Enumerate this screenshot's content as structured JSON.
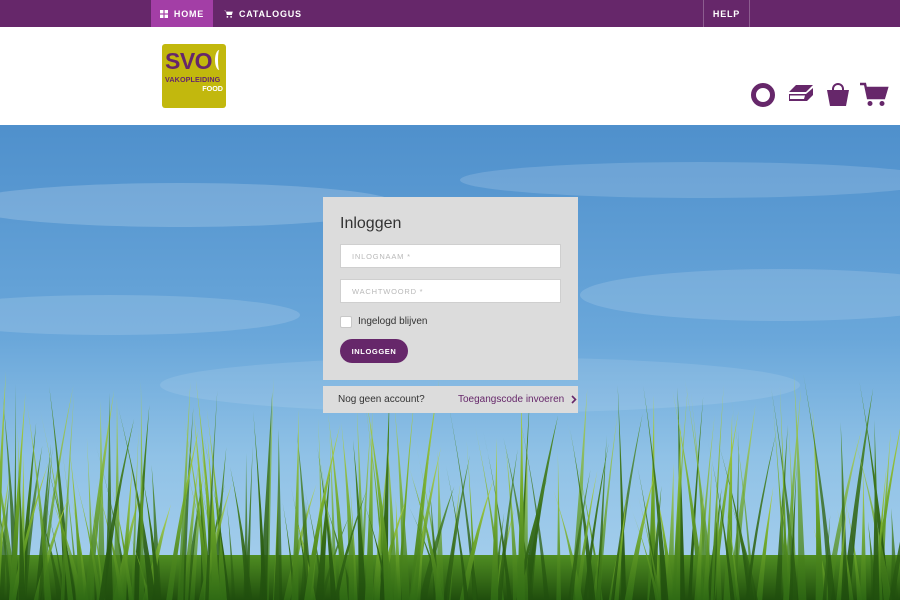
{
  "nav": {
    "home_label": "HOME",
    "catalogus_label": "CATALOGUS",
    "help_label": "HELP",
    "active_color": "#a33ea6",
    "bar_color": "#66276a"
  },
  "logo": {
    "svo": "SVO",
    "vakopleiding": "VAKOPLEIDING",
    "food": "FOOD",
    "background": "#c2b80d"
  },
  "header_icons": [
    "ring-icon",
    "stack-icon",
    "bag-icon",
    "cart-icon"
  ],
  "login": {
    "title": "Inloggen",
    "username_placeholder": "INLOGNAAM *",
    "password_placeholder": "WACHTWOORD *",
    "remember_label": "Ingelogd blijven",
    "button_label": "INLOGGEN"
  },
  "account": {
    "question": "Nog geen account?",
    "code_link": "Toegangscode invoeren"
  },
  "colors": {
    "brand_purple": "#66276a",
    "panel_gray": "#dcdcdc"
  }
}
